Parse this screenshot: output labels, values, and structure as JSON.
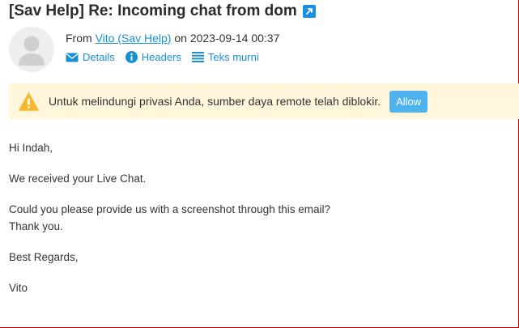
{
  "message": {
    "subject": "[Sav Help] Re: Incoming chat from dom",
    "from_label": "From",
    "sender": "Vito (Sav Help)",
    "date_prefix": "on",
    "date": "2023-09-14 00:37",
    "actions": [
      {
        "label": "Details",
        "icon": "envelope-icon"
      },
      {
        "label": "Headers",
        "icon": "info-icon"
      },
      {
        "label": "Teks murni",
        "icon": "list-icon"
      }
    ]
  },
  "remote_notice": {
    "text": "Untuk melindungi privasi Anda, sumber daya remote telah diblokir.",
    "allow_label": "Allow",
    "icon": "warning-icon"
  },
  "body": {
    "lines": [
      "Hi Indah,",
      "We received your Live Chat.",
      "Could you please provide us with a screenshot through this email?",
      "Thank you.",
      "Best Regards,",
      "Vito"
    ]
  },
  "colors": {
    "accent": "#1a8fd6",
    "notice_bg": "#fff6db",
    "warning": "#f5b82e",
    "allow_button": "#4fb3ef",
    "frame_border": "#cc0000"
  }
}
